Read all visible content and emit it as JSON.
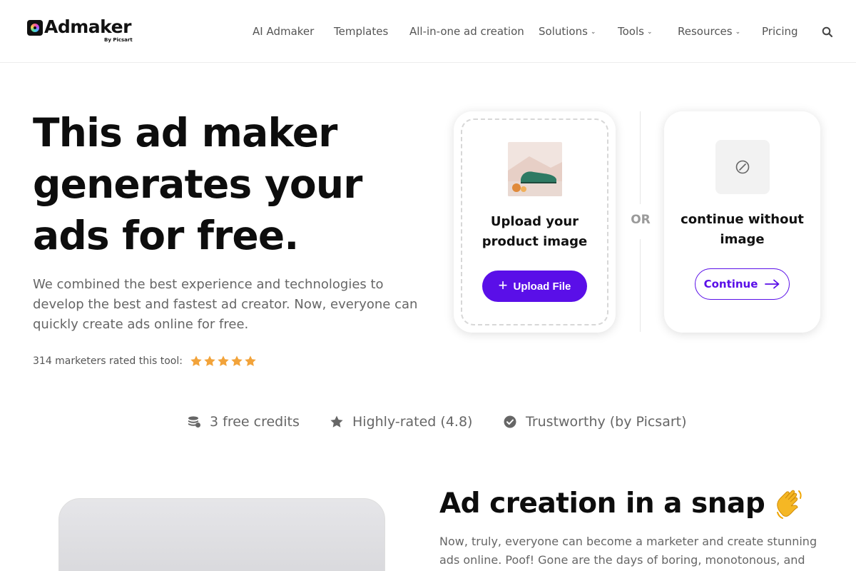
{
  "brand": {
    "name": "Admaker",
    "sub": "By Picsart"
  },
  "nav": {
    "items": [
      {
        "label": "AI Admaker",
        "caret": false
      },
      {
        "label": "Templates",
        "caret": false
      },
      {
        "label": "All-in-one ad creation",
        "caret": false
      },
      {
        "label": "Solutions",
        "caret": true
      },
      {
        "label": "Tools",
        "caret": true
      },
      {
        "label": "Resources",
        "caret": true
      },
      {
        "label": "Pricing",
        "caret": false
      }
    ],
    "search_icon": "search-icon"
  },
  "hero": {
    "title_lines": [
      "This ad maker",
      "generates your",
      "ads for free."
    ],
    "description": "We combined the best experience and technologies to develop the best and fastest ad creator. Now, everyone can quickly create ads online for free.",
    "rating_text": "314 marketers rated this tool:",
    "rating_stars": 5
  },
  "upload_card": {
    "title_line1": "Upload your",
    "title_line2": "product image",
    "button_label": "Upload File"
  },
  "or_label": "OR",
  "continue_card": {
    "title_line1": "continue without",
    "title_line2": "image",
    "button_label": "Continue"
  },
  "features": [
    {
      "icon": "coins-icon",
      "label": "3 free credits"
    },
    {
      "icon": "star-icon",
      "label": "Highly-rated (4.8)"
    },
    {
      "icon": "check-circle-icon",
      "label": "Trustworthy (by Picsart)"
    }
  ],
  "snap_section": {
    "title": "Ad creation in a snap",
    "description": "Now, truly, everyone can become a marketer and create stunning ads online. Poof! Gone are the days of boring, monotonous, and expensive ad"
  },
  "colors": {
    "accent": "#5a0fe8",
    "star": "#f2a33a",
    "text_muted": "#666666"
  }
}
